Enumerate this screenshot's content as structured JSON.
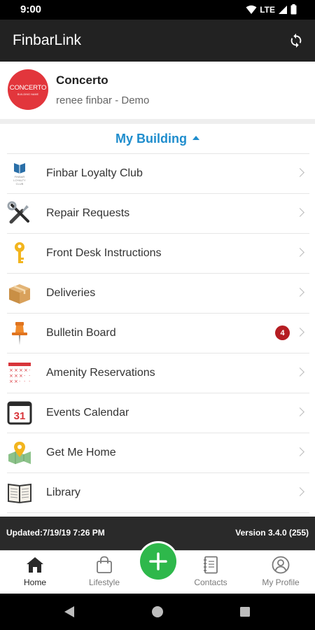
{
  "status_bar": {
    "time": "9:00",
    "network": "LTE"
  },
  "app_bar": {
    "title": "FinbarLink"
  },
  "building": {
    "logo_text": "CONCERTO",
    "logo_subtext": "BUILDING NAME",
    "name": "Concerto",
    "subtitle": "renee finbar - Demo"
  },
  "section": {
    "title": "My Building"
  },
  "menu": {
    "items": [
      {
        "label": "Finbar Loyalty Club",
        "icon": "loyalty-club-icon"
      },
      {
        "label": "Repair Requests",
        "icon": "tools-icon"
      },
      {
        "label": "Front Desk Instructions",
        "icon": "key-icon"
      },
      {
        "label": "Deliveries",
        "icon": "package-icon"
      },
      {
        "label": "Bulletin Board",
        "icon": "pushpin-icon",
        "badge": "4"
      },
      {
        "label": "Amenity Reservations",
        "icon": "reservation-grid-icon"
      },
      {
        "label": "Events Calendar",
        "icon": "calendar-icon",
        "icon_text": "31"
      },
      {
        "label": "Get Me Home",
        "icon": "map-pin-icon"
      },
      {
        "label": "Library",
        "icon": "book-icon"
      }
    ]
  },
  "loyalty_icon_text": {
    "line1": "FINBAR",
    "line2": "LOYALTY",
    "line3": "CLUB"
  },
  "footer": {
    "updated": "Updated:7/19/19 7:26 PM",
    "version": "Version 3.4.0 (255)"
  },
  "bottom_nav": {
    "home": "Home",
    "lifestyle": "Lifestyle",
    "contacts": "Contacts",
    "profile": "My Profile"
  },
  "colors": {
    "accent": "#1f8dcd",
    "app_bar": "#222222",
    "fab": "#2eb84b",
    "badge": "#b51d22",
    "logo": "#e2363c"
  }
}
